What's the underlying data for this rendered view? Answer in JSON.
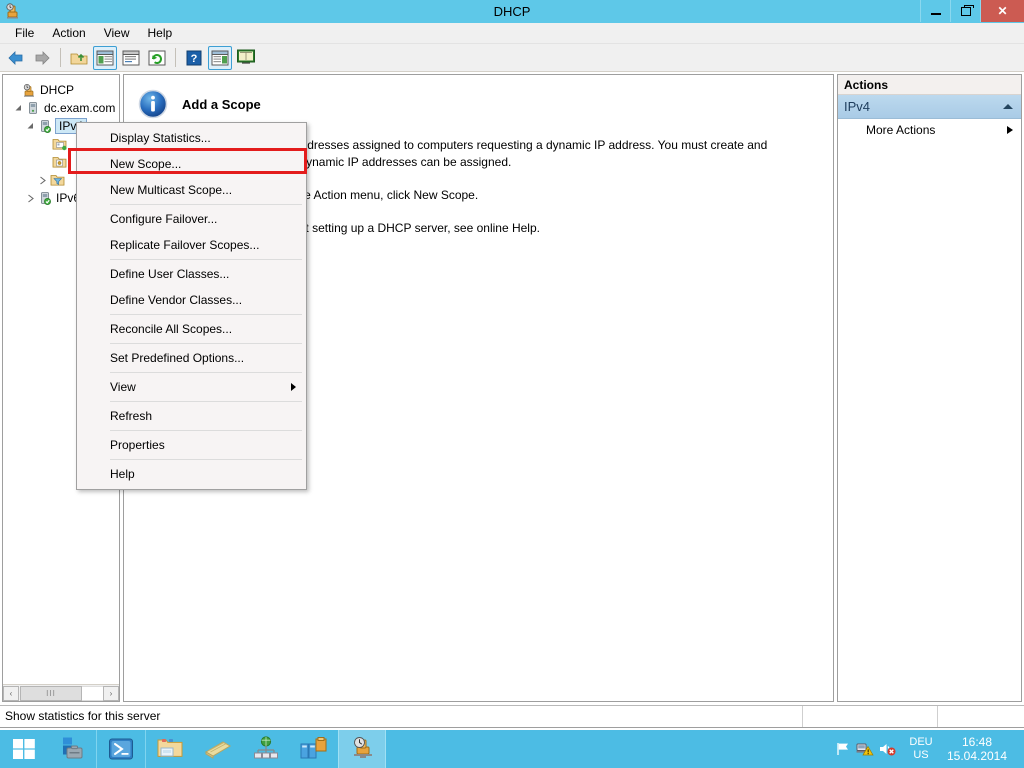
{
  "window": {
    "title": "DHCP",
    "icon": "dhcp-server-icon",
    "minimize_label": "Minimize",
    "maximize_label": "Restore",
    "close_label": "Close"
  },
  "menubar": {
    "items": [
      {
        "label": "File",
        "name": "menu-file"
      },
      {
        "label": "Action",
        "name": "menu-action"
      },
      {
        "label": "View",
        "name": "menu-view"
      },
      {
        "label": "Help",
        "name": "menu-help"
      }
    ]
  },
  "toolbar": {
    "buttons": [
      {
        "icon": "back-arrow-icon",
        "title": "Back"
      },
      {
        "icon": "forward-arrow-icon",
        "title": "Forward"
      },
      {
        "icon": "up-folder-icon",
        "title": "Up One Level"
      },
      {
        "icon": "show-hide-tree-icon",
        "title": "Show/Hide Console Tree"
      },
      {
        "icon": "properties-icon",
        "title": "Properties"
      },
      {
        "icon": "refresh-icon",
        "title": "Refresh"
      },
      {
        "icon": "help-icon",
        "title": "Help"
      },
      {
        "icon": "show-hide-action-pane-icon",
        "title": "Show/Hide Action Pane"
      },
      {
        "icon": "export-list-icon",
        "title": "Export List"
      }
    ]
  },
  "tree": {
    "nodes": [
      {
        "label": "DHCP",
        "icon": "dhcp-root-icon",
        "indent": 0,
        "twisty": "none",
        "selected": false
      },
      {
        "label": "dc.exam.com",
        "icon": "server-icon",
        "indent": 1,
        "twisty": "expanded",
        "selected": false
      },
      {
        "label": "IPv4",
        "icon": "ipv4-server-icon",
        "indent": 2,
        "twisty": "expanded",
        "selected": true
      },
      {
        "label": "",
        "icon": "scope-folder-icon",
        "indent": 3,
        "twisty": "none",
        "selected": false
      },
      {
        "label": "",
        "icon": "server-options-folder-icon",
        "indent": 3,
        "twisty": "none",
        "selected": false
      },
      {
        "label": "",
        "icon": "policies-filter-folder-icon",
        "indent": 3,
        "twisty": "collapsed",
        "selected": false
      },
      {
        "label": "IPv6",
        "icon": "ipv6-server-icon",
        "indent": 1,
        "twisty": "collapsed",
        "selected": false
      }
    ],
    "hscroll": {
      "left_label": "‹",
      "right_label": "›",
      "thumb_label": "III"
    }
  },
  "content": {
    "icon": "info-icon",
    "title": "Add a Scope",
    "paragraphs": [
      "A scope is a range of IP addresses assigned to computers requesting a dynamic IP address. You must create and configure a scope before dynamic IP addresses can be assigned.",
      "To add a new scope, on the Action menu, click New Scope.",
      "For more information about setting up a DHCP server, see online Help."
    ]
  },
  "actions": {
    "title": "Actions",
    "group_label": "IPv4",
    "group_caret": "collapse-caret-icon",
    "items": [
      {
        "label": "More Actions",
        "caret": "submenu-caret-icon"
      }
    ]
  },
  "context_menu": {
    "items": [
      {
        "label": "Display Statistics...",
        "type": "item",
        "highlighted": false
      },
      {
        "label": "New Scope...",
        "type": "item",
        "highlighted": true
      },
      {
        "label": "New Multicast Scope...",
        "type": "item",
        "highlighted": false
      },
      {
        "label": "",
        "type": "separator"
      },
      {
        "label": "Configure Failover...",
        "type": "item",
        "highlighted": false
      },
      {
        "label": "Replicate Failover Scopes...",
        "type": "item",
        "highlighted": false
      },
      {
        "label": "",
        "type": "separator"
      },
      {
        "label": "Define User Classes...",
        "type": "item",
        "highlighted": false
      },
      {
        "label": "Define Vendor Classes...",
        "type": "item",
        "highlighted": false
      },
      {
        "label": "",
        "type": "separator"
      },
      {
        "label": "Reconcile All Scopes...",
        "type": "item",
        "highlighted": false
      },
      {
        "label": "",
        "type": "separator"
      },
      {
        "label": "Set Predefined Options...",
        "type": "item",
        "highlighted": false
      },
      {
        "label": "",
        "type": "separator"
      },
      {
        "label": "View",
        "type": "submenu",
        "highlighted": false
      },
      {
        "label": "",
        "type": "separator"
      },
      {
        "label": "Refresh",
        "type": "item",
        "highlighted": false
      },
      {
        "label": "",
        "type": "separator"
      },
      {
        "label": "Properties",
        "type": "item",
        "highlighted": false
      },
      {
        "label": "",
        "type": "separator"
      },
      {
        "label": "Help",
        "type": "item",
        "highlighted": false
      }
    ],
    "highlight_color": "#e31c1c"
  },
  "statusbar": {
    "message": "Show statistics for this server"
  },
  "taskbar": {
    "start_label": "Start",
    "items": [
      {
        "icon": "server-manager-icon",
        "name": "taskbar-server-manager",
        "running": false
      },
      {
        "icon": "powershell-icon",
        "name": "taskbar-powershell",
        "running": false
      },
      {
        "icon": "file-explorer-icon",
        "name": "taskbar-file-explorer",
        "running": false
      },
      {
        "icon": "books-icon",
        "name": "taskbar-books",
        "running": false
      },
      {
        "icon": "network-globe-icon",
        "name": "taskbar-network",
        "running": false
      },
      {
        "icon": "dns-manager-icon",
        "name": "taskbar-dns-manager",
        "running": false
      },
      {
        "icon": "dhcp-console-icon",
        "name": "taskbar-dhcp-console",
        "running": true
      }
    ],
    "tray": {
      "flag_icon": "action-center-flag-icon",
      "network_icon": "network-warning-icon",
      "volume_icon": "volume-muted-icon",
      "language_line1": "DEU",
      "language_line2": "US",
      "time": "16:48",
      "date": "15.04.2014"
    }
  },
  "colors": {
    "titlebar": "#5ec8e8",
    "taskbar": "#4cbce4",
    "close_button": "#cc5b52",
    "accent": "#3c9fd4",
    "highlight_red": "#e31c1c",
    "actions_group": "#a9cbe6"
  }
}
